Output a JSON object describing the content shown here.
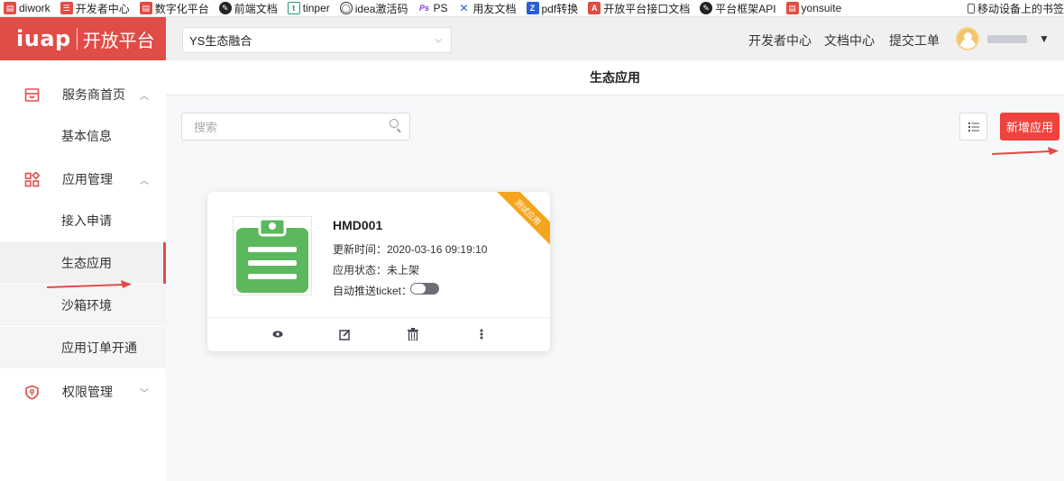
{
  "bookmarks": [
    {
      "label": "diwork",
      "icon": "diwork-icon",
      "color": "#e14c46"
    },
    {
      "label": "开发者中心",
      "icon": "devcenter-icon",
      "color": "#e14c46"
    },
    {
      "label": "数字化平台",
      "icon": "digital-icon",
      "color": "#e14c46"
    },
    {
      "label": "前端文档",
      "icon": "frontend-icon",
      "color": "#222222"
    },
    {
      "label": "tinper",
      "icon": "tinper-icon",
      "color": "#1d9e74"
    },
    {
      "label": "idea激活码",
      "icon": "globe-icon",
      "color": "#333333"
    },
    {
      "label": "PS",
      "icon": "ps-icon",
      "color": "#7d3cf0"
    },
    {
      "label": "用友文档",
      "icon": "yonyou-icon",
      "color": "#2a5fd6"
    },
    {
      "label": "pdf转换",
      "icon": "pdf-icon",
      "color": "#2a5fd6"
    },
    {
      "label": "开放平台接口文档",
      "icon": "openapi-icon",
      "color": "#e14c46"
    },
    {
      "label": "平台框架API",
      "icon": "framework-icon",
      "color": "#222222"
    },
    {
      "label": "yonsuite",
      "icon": "yonsuite-icon",
      "color": "#e14c46"
    }
  ],
  "bookmarks_right": "移动设备上的书签",
  "logo": {
    "brand": "iuap",
    "product": "开放平台",
    "color": "#e14c46"
  },
  "header": {
    "select_value": "YS生态融合",
    "links": [
      "开发者中心",
      "文档中心",
      "提交工单"
    ]
  },
  "sidebar": {
    "groups": [
      {
        "label": "服务商首页",
        "icon": "store-icon",
        "expanded": true,
        "items": [
          "基本信息"
        ]
      },
      {
        "label": "应用管理",
        "icon": "apps-grid-icon",
        "expanded": true,
        "items": [
          "接入申请",
          "生态应用",
          "沙箱环境",
          "应用订单开通"
        ]
      },
      {
        "label": "权限管理",
        "icon": "shield-icon",
        "expanded": false,
        "items": []
      }
    ],
    "active_item": "生态应用"
  },
  "main": {
    "title": "生态应用",
    "search_placeholder": "搜索",
    "add_button": "新增应用"
  },
  "card": {
    "ribbon": "测试应用",
    "name": "HMD001",
    "update_time": "更新时间：2020-03-16 09:19:10",
    "status": "应用状态：未上架",
    "auto_push": "自动推送ticket：",
    "auto_push_enabled": false,
    "actions": [
      "view-icon",
      "edit-icon",
      "delete-icon",
      "more-icon"
    ]
  },
  "colors": {
    "accent": "#e14c46",
    "app_icon": "#5cb85c",
    "ribbon": "#f5a41d"
  }
}
